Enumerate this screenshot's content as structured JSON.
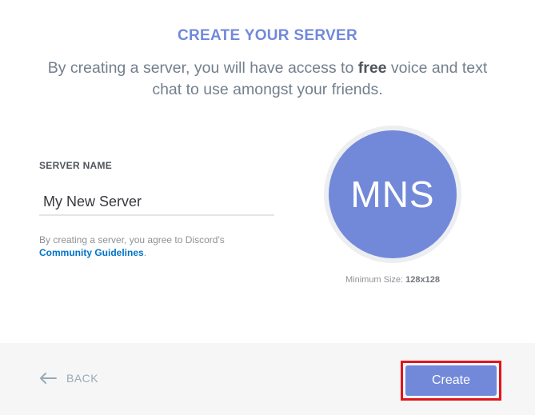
{
  "header": {
    "title": "CREATE YOUR SERVER",
    "subtitle_before": "By creating a server, you will have access to ",
    "subtitle_bold": "free",
    "subtitle_after": " voice and text chat to use amongst your friends."
  },
  "form": {
    "label": "SERVER NAME",
    "server_name_value": "My New Server",
    "agreement_text": "By creating a server, you agree to Discord's ",
    "guidelines_link": "Community Guidelines",
    "agreement_end": "."
  },
  "icon": {
    "initials": "MNS",
    "min_size_label": "Minimum Size: ",
    "min_size_value": "128x128"
  },
  "footer": {
    "back_label": "BACK",
    "create_label": "Create"
  },
  "colors": {
    "accent": "#7289da",
    "link": "#0073c6",
    "highlight_outline": "#e3141c",
    "footer_bg": "#f6f6f7"
  }
}
